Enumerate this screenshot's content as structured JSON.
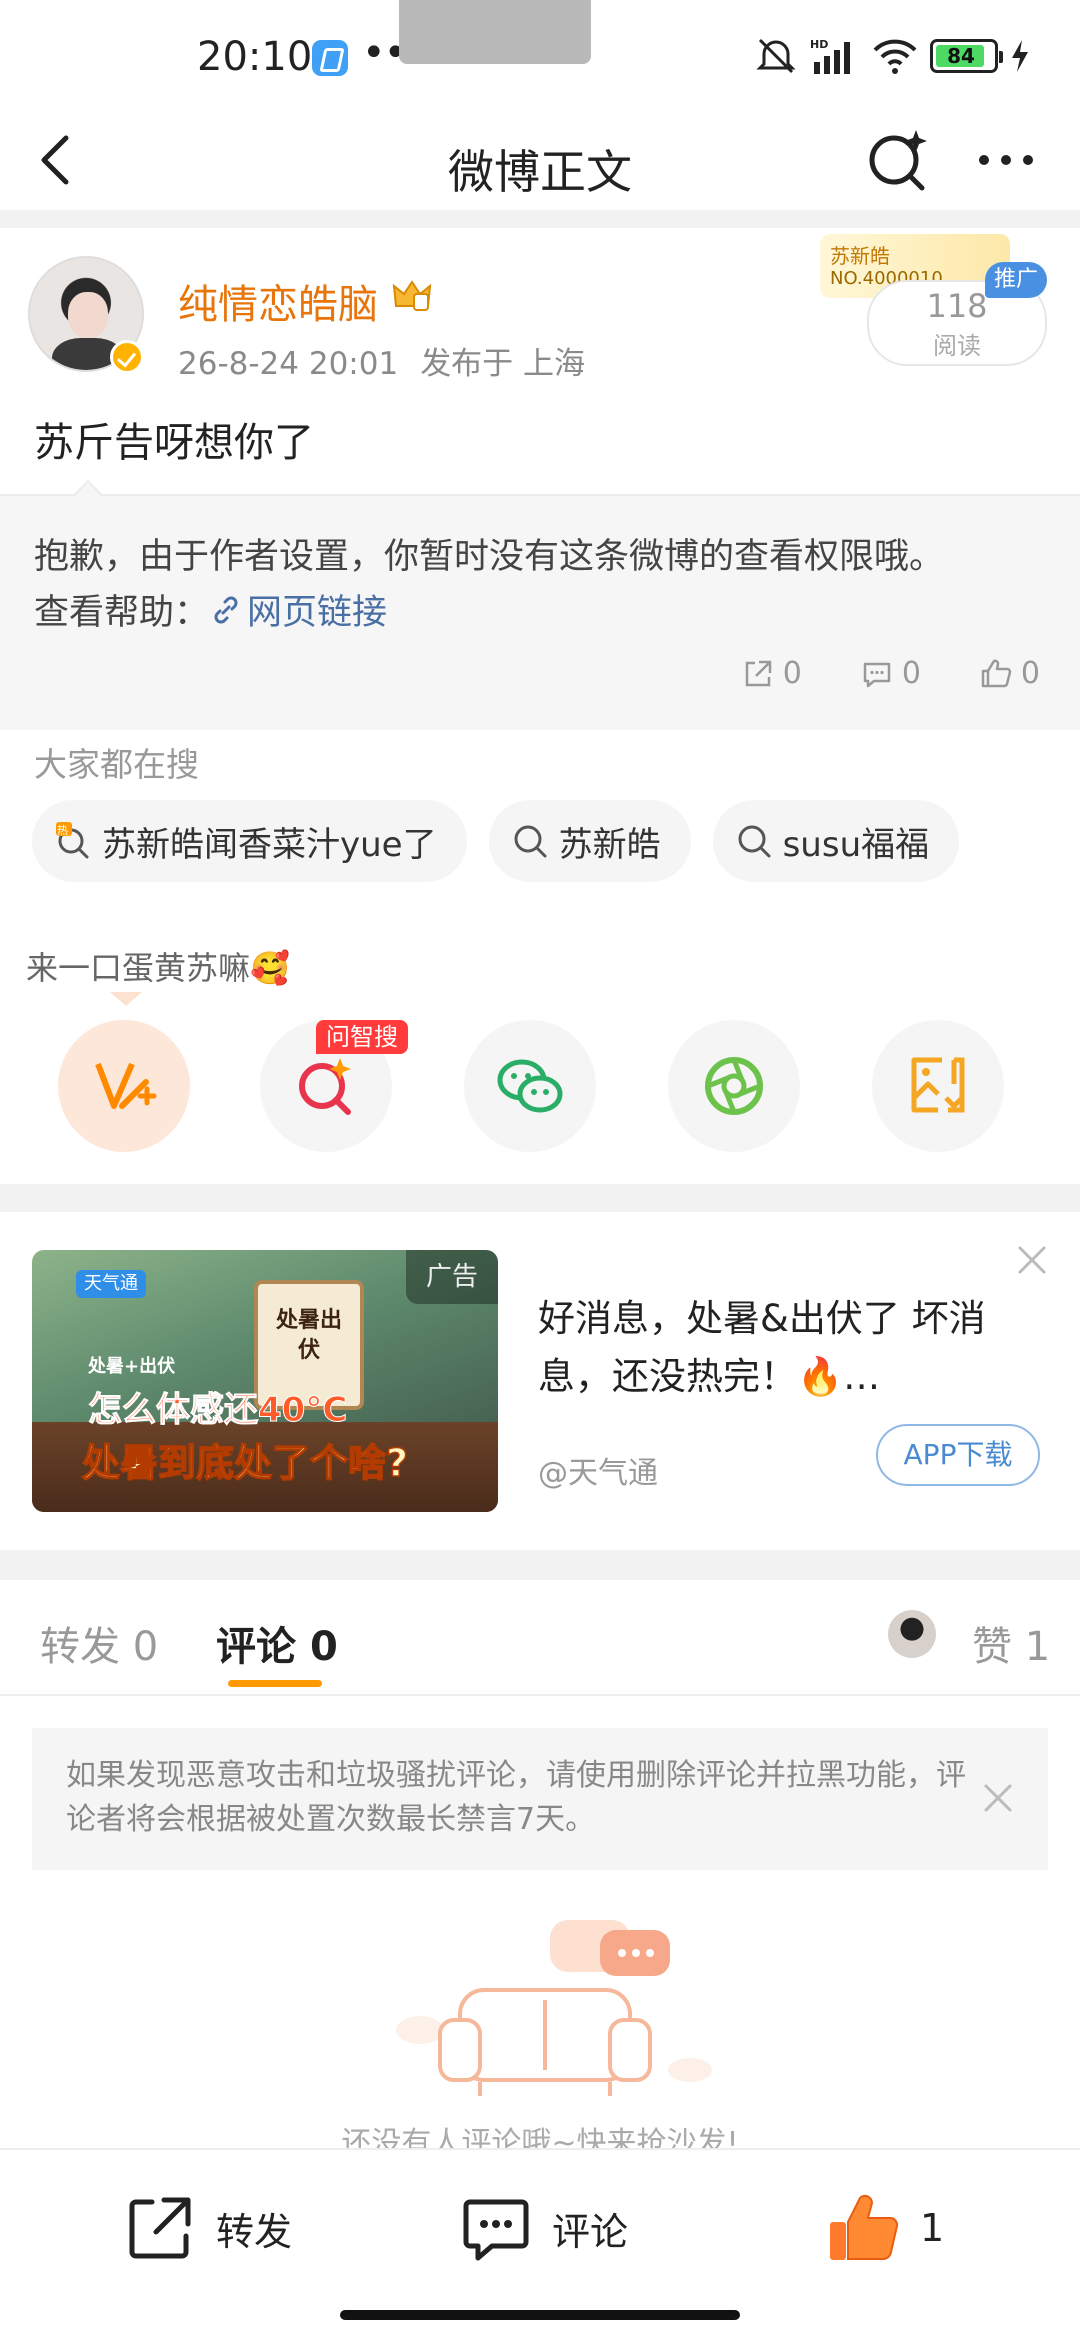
{
  "status_bar": {
    "time": "20:10",
    "dots": "•••",
    "battery": "84",
    "icons": [
      "app-icon",
      "mute-icon",
      "hd-signal-icon",
      "wifi-icon",
      "battery-icon",
      "charging-icon"
    ]
  },
  "nav": {
    "title": "微博正文",
    "icons": [
      "back-icon",
      "ai-search-icon",
      "more-icon"
    ]
  },
  "post": {
    "username": "纯情恋皓脑",
    "date": "26-8-24 20:01",
    "location": "发布于 上海",
    "text": "苏斤告呀想你了",
    "promo_name": "苏新皓",
    "promo_no": "NO.4000010",
    "reads": "118",
    "reads_label": "阅读",
    "promo_badge": "推广"
  },
  "notice": {
    "message": "抱歉，由于作者设置，你暂时没有这条微博的查看权限哦。",
    "help_label": "查看帮助：",
    "link_text": "网页链接",
    "reposts": "0",
    "comments": "0",
    "likes": "0"
  },
  "hot_search": {
    "title": "大家都在搜",
    "chips": [
      "苏新皓闻香菜汁yue了",
      "苏新皓",
      "susu福福"
    ]
  },
  "share": {
    "caption": "来一口蛋黄苏嘛🥰",
    "ai_badge": "问智搜",
    "buttons": [
      "weibo-repost",
      "ai-search",
      "wechat",
      "moments",
      "save-image"
    ]
  },
  "ad": {
    "label": "广告",
    "logo": "天气通",
    "calendar_text": "处暑出伏",
    "small_text": "处暑+出伏",
    "line1": "怎么体感还40°C",
    "line2": "处暑到底处了个啥?",
    "title": "好消息，处暑&出伏了 坏消息，还没热完！🔥…",
    "source": "@天气通",
    "download": "APP下载"
  },
  "tabs": {
    "repost_label": "转发",
    "repost_count": "0",
    "comment_label": "评论",
    "comment_count": "0",
    "like_label": "赞",
    "like_count": "1"
  },
  "tip": "如果发现恶意攻击和垃圾骚扰评论，请使用删除评论并拉黑功能，评论者将会根据被处置次数最长禁言7天。",
  "empty_text": "还没有人评论哦~快来抢沙发!",
  "bottom_bar": {
    "repost": "转发",
    "comment": "评论",
    "like_count": "1"
  },
  "colors": {
    "brand_orange": "#ff9a00",
    "username": "#e8740a",
    "link": "#4a6fa5"
  }
}
